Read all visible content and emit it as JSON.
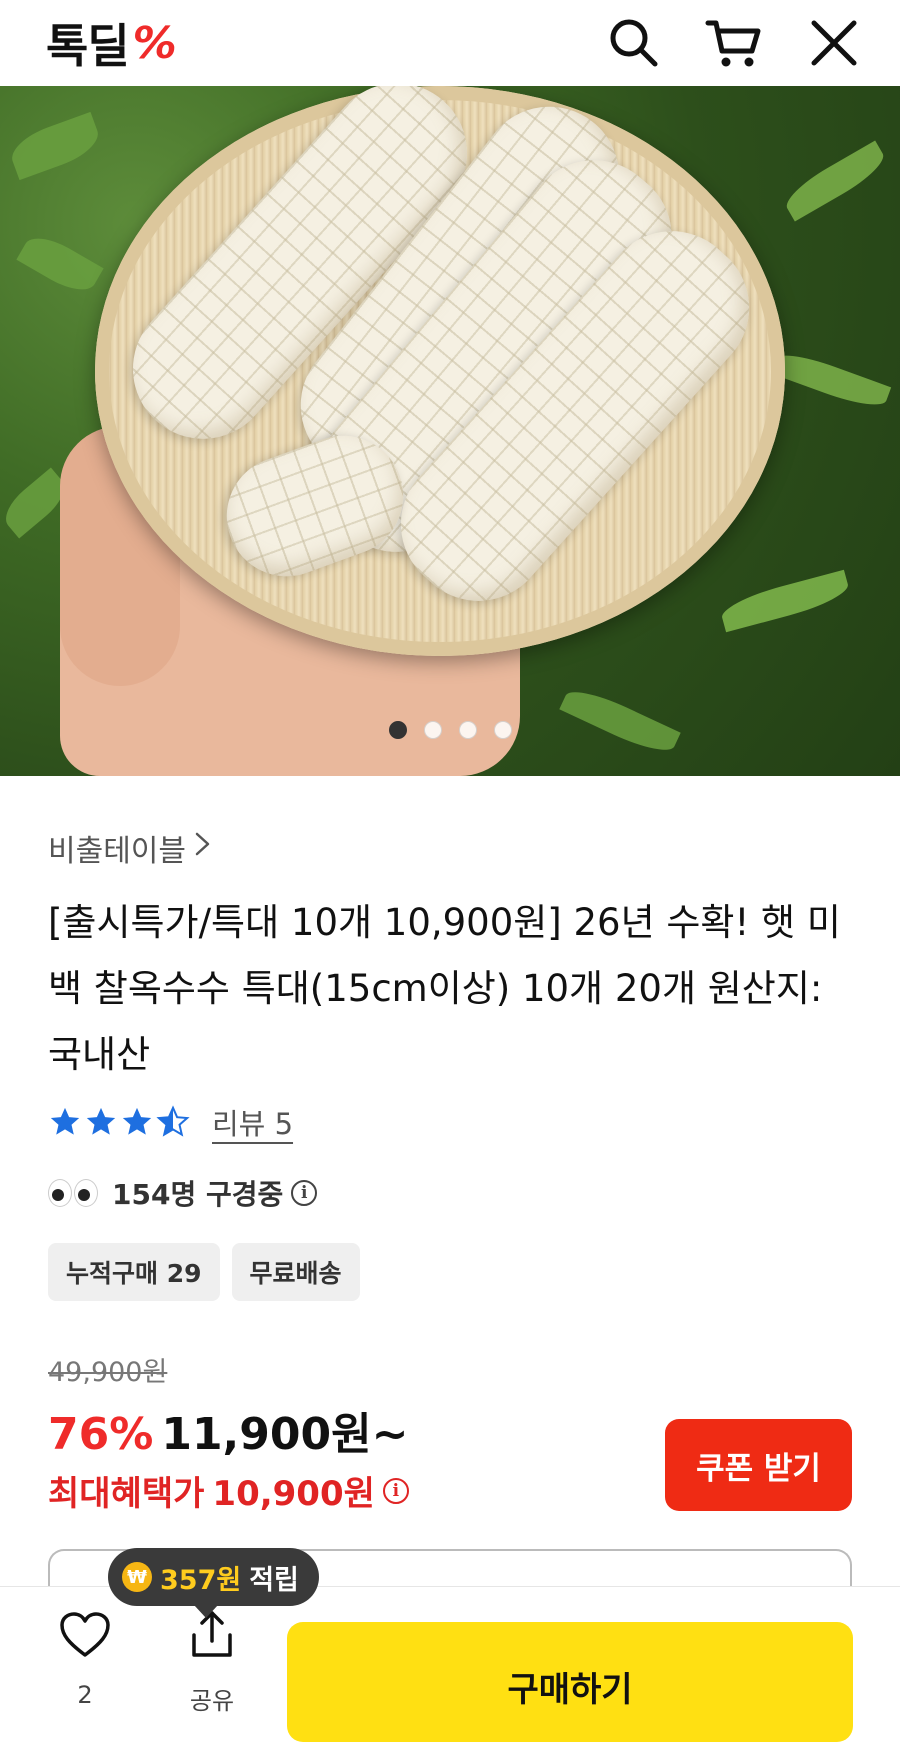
{
  "header": {
    "logo_text": "톡딜",
    "logo_mark": "%",
    "icons": [
      "search-icon",
      "cart-icon",
      "close-icon"
    ]
  },
  "carousel": {
    "total_slides": 4,
    "active_index": 0
  },
  "product": {
    "store_name": "비출테이블",
    "title": "[출시특가/특대 10개 10,900원] 26년 수확! 햇 미백 찰옥수수 특대(15cm이상) 10개 20개 원산지: 국내산",
    "rating": 4.5,
    "review_label": "리뷰 5",
    "viewers_text": "154명 구경중",
    "badges": [
      "누적구매 29",
      "무료배송"
    ],
    "original_price": "49,900원",
    "discount": "76%",
    "price": "11,900원~",
    "max_benefit_label": "최대혜택가",
    "max_benefit_price": "10,900원",
    "coupon_button": "쿠폰 받기"
  },
  "bottom_bar": {
    "like_count": "2",
    "share_label": "공유",
    "buy_button": "구매하기",
    "points_amount": "357원",
    "points_label": "적립",
    "coin_symbol": "₩"
  },
  "colors": {
    "brand_red": "#ef2b2a",
    "coupon_red": "#ef2b14",
    "buy_yellow": "#ffe012",
    "star_blue": "#1e6fe0"
  }
}
